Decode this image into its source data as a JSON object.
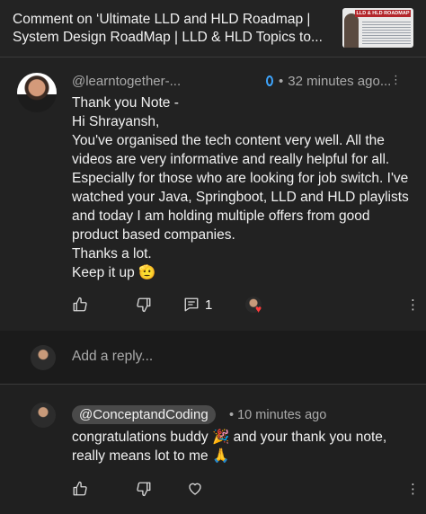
{
  "header": {
    "title": "Comment on ‘Ultimate LLD and HLD Roadmap | System Design RoadMap | LLD & HLD Topics to...",
    "thumbnail_caption": "LLD & HLD ROADMAP"
  },
  "comment": {
    "handle": "@learntogether-...",
    "time": "32 minutes ago...",
    "separator": "•",
    "lines": [
      "Thank you Note -",
      "Hi Shrayansh,",
      "You've organised the tech content very well. All the videos are very informative and really helpful for all. Especially for those who are looking for job switch. I've watched your Java, Springboot, LLD and HLD playlists and today I am holding multiple offers from good product based companies.",
      "Thanks a lot.",
      "Keep it up"
    ],
    "emoji_end": "🫡",
    "reply_count": "1",
    "more": "⋮"
  },
  "reply_box": {
    "placeholder": "Add a reply..."
  },
  "reply": {
    "author": "@ConceptandCoding",
    "separator": "•",
    "time": "10 minutes ago",
    "text_part1": "congratulations buddy ",
    "emoji_party": "🎉",
    "text_part2": " and your thank you note, really means lot to me ",
    "emoji_pray": "🙏",
    "more": "⋮"
  },
  "icons": {
    "like": "thumb-up-icon",
    "dislike": "thumb-down-icon",
    "replies": "reply-comment-icon",
    "heart": "heart-icon",
    "more": "more-vertical-icon",
    "verified_drop": "water-drop-icon"
  },
  "colors": {
    "background": "#202020",
    "accent_blue": "#3ea6ff",
    "heart_red": "#ff3b3b",
    "chip_bg": "#4a4a4a"
  }
}
